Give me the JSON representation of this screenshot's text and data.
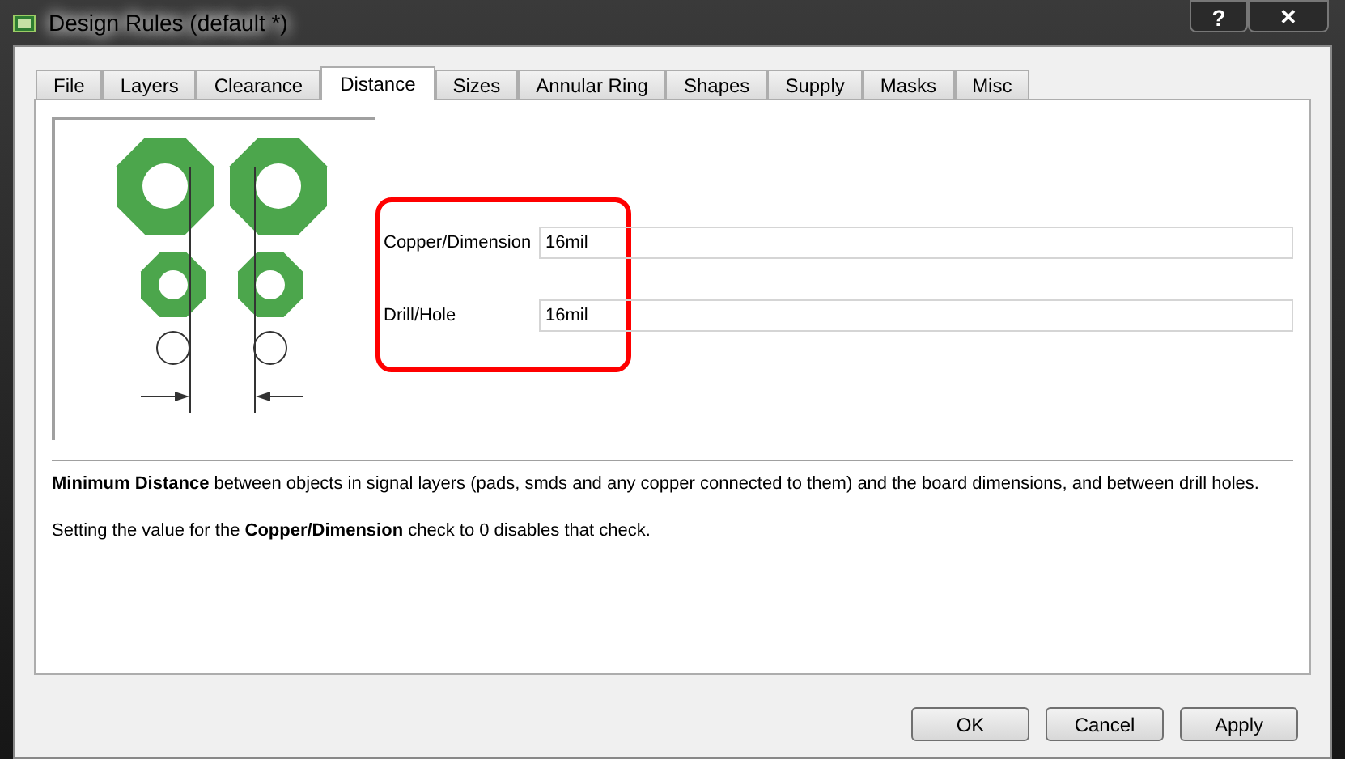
{
  "window": {
    "title": "Design Rules (default *)",
    "help_button": "?",
    "close_button": "✕"
  },
  "tabs": [
    {
      "label": "File",
      "selected": false
    },
    {
      "label": "Layers",
      "selected": false
    },
    {
      "label": "Clearance",
      "selected": false
    },
    {
      "label": "Distance",
      "selected": true
    },
    {
      "label": "Sizes",
      "selected": false
    },
    {
      "label": "Annular Ring",
      "selected": false
    },
    {
      "label": "Shapes",
      "selected": false
    },
    {
      "label": "Supply",
      "selected": false
    },
    {
      "label": "Masks",
      "selected": false
    },
    {
      "label": "Misc",
      "selected": false
    }
  ],
  "fields": [
    {
      "label": "Copper/Dimension",
      "value": "16mil"
    },
    {
      "label": "Drill/Hole",
      "value": "16mil"
    }
  ],
  "description": [
    "**Minimum Distance** between objects in signal layers (pads, smds and any copper connected to them) and the board dimensions, and between drill holes.",
    "Setting the value for the **Copper/Dimension** check to 0 disables that check."
  ],
  "buttons": [
    "OK",
    "Cancel",
    "Apply"
  ]
}
